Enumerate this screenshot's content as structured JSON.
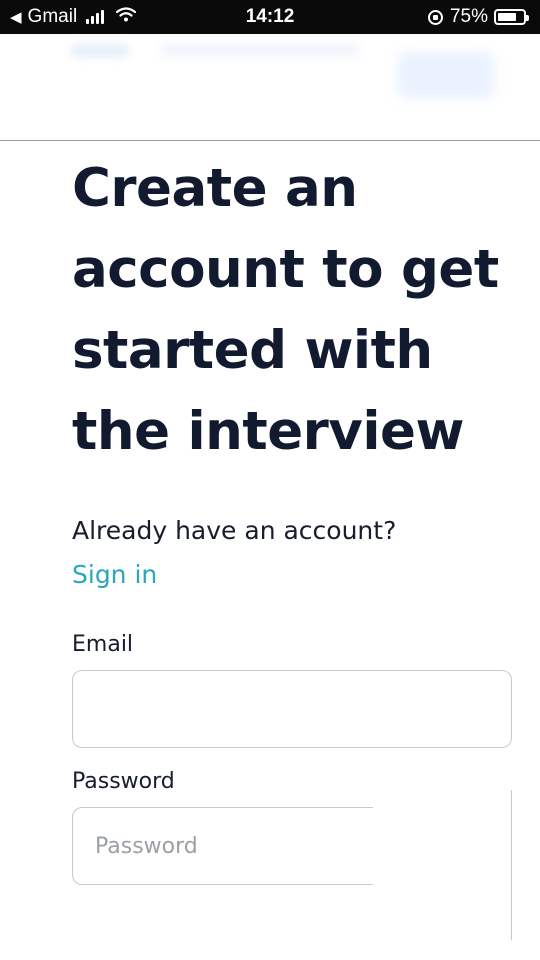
{
  "status_bar": {
    "back_app": "Gmail",
    "time": "14:12",
    "battery_percent": "75%",
    "icons": [
      "back-arrow-icon",
      "signal-icon",
      "wifi-icon",
      "rotation-lock-icon",
      "battery-icon"
    ]
  },
  "headline": "Create an account to get started with the interview",
  "signin_prompt": {
    "text": "Already have an account?",
    "link": "Sign in",
    "link_color": "#2aa8bb"
  },
  "form": {
    "email": {
      "label": "Email",
      "value": "",
      "placeholder": ""
    },
    "password": {
      "label": "Password",
      "value": "",
      "placeholder": "Password"
    }
  },
  "colors": {
    "heading": "#111a2e",
    "accent": "#2aa8bb",
    "border": "#c5c9cf"
  }
}
